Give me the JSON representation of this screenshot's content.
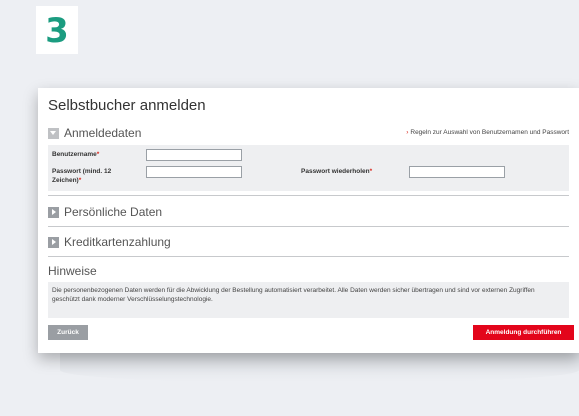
{
  "step_number": "3",
  "form": {
    "title": "Selbstbucher anmelden",
    "rules_link": "Regeln zur Auswahl von Benutzernamen und Passwort",
    "sections": {
      "login": "Anmeldedaten",
      "personal": "Persönliche Daten",
      "payment": "Kreditkartenzahlung"
    },
    "fields": {
      "username": {
        "label": "Benutzername",
        "required_mark": "*",
        "value": ""
      },
      "password": {
        "label_line1": "Passwort (mind. 12",
        "label_line2": "Zeichen)",
        "required_mark": "*",
        "value": ""
      },
      "password_repeat": {
        "label": "Passwort wiederholen",
        "required_mark": "*",
        "value": ""
      }
    },
    "hints": {
      "title": "Hinweise",
      "text": "Die personenbezogenen Daten werden für die Abwicklung der Bestellung automatisiert verarbeitet. Alle Daten werden sicher übertragen und sind vor externen Zugriffen geschützt dank moderner Verschlüsselungstechnologie."
    },
    "buttons": {
      "back": "Zurück",
      "submit": "Anmeldung durchführen"
    }
  },
  "icons": {
    "section_open": "caret-down-icon",
    "section_closed": "caret-right-icon",
    "rules_link": "arrow-right-icon"
  },
  "colors": {
    "accent_green": "#1b9c80",
    "submit_red": "#e3051b",
    "back_gray": "#9a9ea3"
  }
}
